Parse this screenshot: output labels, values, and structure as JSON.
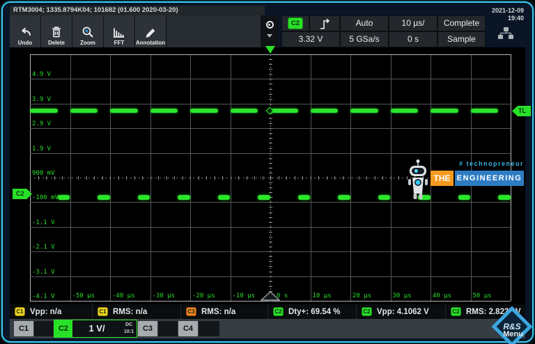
{
  "window": {
    "title": "RTM3004; 1335.8794K04; 101682 (01.600 2020-03-20)"
  },
  "datetime": {
    "date": "2021-12-09",
    "time": "19:40"
  },
  "toolbar": {
    "buttons": [
      {
        "name": "undo",
        "label": "Undo"
      },
      {
        "name": "delete",
        "label": "Delete"
      },
      {
        "name": "zoom",
        "label": "Zoom"
      },
      {
        "name": "fft",
        "label": "FFT"
      },
      {
        "name": "annotation",
        "label": "Annotation"
      }
    ]
  },
  "acquisition": {
    "trigger_source_badge": "C2",
    "trigger_mode": "Auto",
    "timebase": "10 µs/",
    "acquisition_state": "Complete",
    "trigger_level": "3.32 V",
    "sample_rate": "5 GSa/s",
    "horizontal_position": "0 s",
    "acquisition_mode": "Sample"
  },
  "graticule": {
    "voltage_labels": [
      "4.9 V",
      "3.9 V",
      "2.9 V",
      "1.9 V",
      "900 mV",
      "-100 mV",
      "-1.1 V",
      "-2.1 V",
      "-3.1 V",
      "-4.1 V"
    ],
    "time_labels": [
      "-50 µs",
      "-40 µs",
      "-30 µs",
      "-20 µs",
      "-10 µs",
      "10 µs",
      "20 µs",
      "30 µs",
      "40 µs",
      "50 µs"
    ],
    "zero_time_label": "0 s",
    "channel_marker": "C2",
    "trigger_level_marker": "TL"
  },
  "waveform": {
    "type": "square",
    "channel": "C2",
    "high_level_v": 3.6,
    "low_level_v": 0.1,
    "period_us": 10,
    "duty_cycle_pct": 69.54,
    "volts_per_div": 1,
    "time_per_div_us": 10
  },
  "measurements": [
    {
      "channel": "C1",
      "metric": "Vpp:",
      "value": "n/a"
    },
    {
      "channel": "C1",
      "metric": "RMS:",
      "value": "n/a"
    },
    {
      "channel": "C3",
      "metric": "RMS:",
      "value": "n/a"
    },
    {
      "channel": "C2",
      "metric": "Dty+:",
      "value": "69.54 %"
    },
    {
      "channel": "C2",
      "metric": "Vpp:",
      "value": "4.1062 V"
    },
    {
      "channel": "C2",
      "metric": "RMS:",
      "value": "2.8237 V"
    }
  ],
  "channel_bar": {
    "c1": "C1",
    "c2": "C2",
    "c3": "C3",
    "c4": "C4",
    "active_scale": "1 V/",
    "coupling": "DC",
    "probe": "10:1",
    "menu": "Menu"
  },
  "watermark": {
    "hashtag": "# technopreneur",
    "word1": "THE",
    "word2": "ENGINEERING"
  },
  "brand": {
    "logo_text": "R&S"
  },
  "colors": {
    "ch1": "#f2d41e",
    "ch2": "#29e029",
    "ch3": "#ef8220",
    "ch4": "#a6abaf",
    "waveform": "#2be52b",
    "accent_cyan": "#3cc9f2",
    "grid_line": "#53585b",
    "grid_border": "#b4b8ba"
  }
}
